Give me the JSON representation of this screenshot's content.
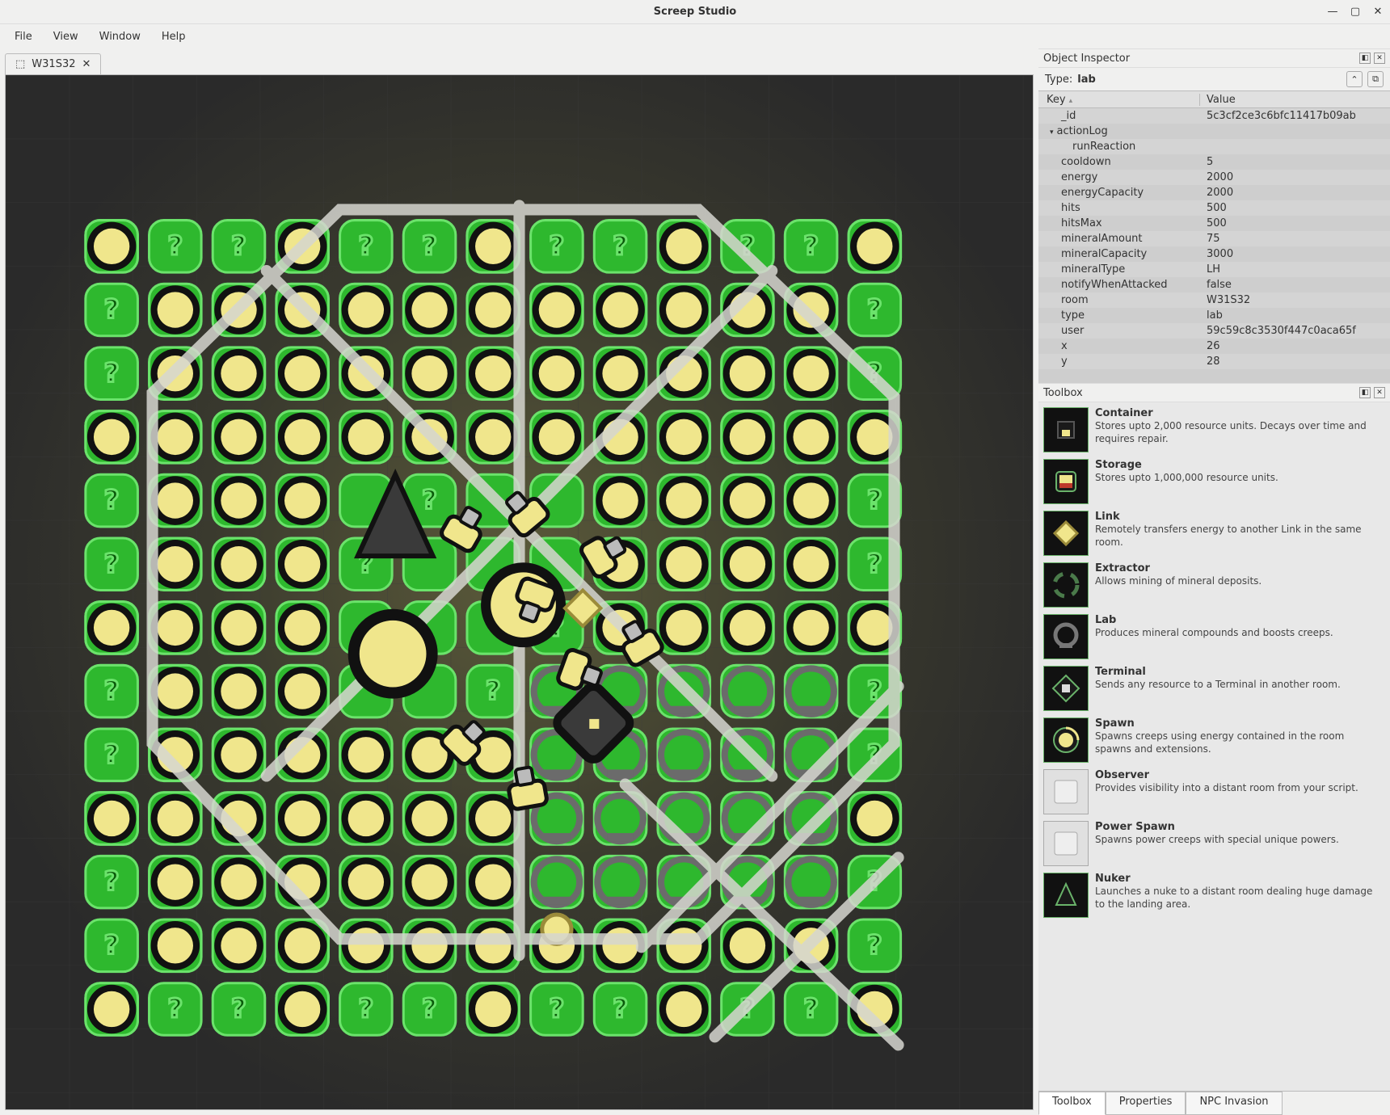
{
  "window": {
    "title": "Screep Studio"
  },
  "menu": {
    "file": "File",
    "view": "View",
    "window": "Window",
    "help": "Help"
  },
  "tab": {
    "label": "W31S32",
    "close": "✕"
  },
  "inspector": {
    "panel_title": "Object Inspector",
    "type_label": "Type:",
    "type_value": "lab",
    "key_header": "Key",
    "value_header": "Value",
    "rows": [
      {
        "k": "_id",
        "v": "5c3cf2ce3c6bfc11417b09ab"
      },
      {
        "k": "actionLog",
        "v": "",
        "expand": true
      },
      {
        "k": "runReaction",
        "v": "",
        "indent": 1
      },
      {
        "k": "cooldown",
        "v": "5"
      },
      {
        "k": "energy",
        "v": "2000"
      },
      {
        "k": "energyCapacity",
        "v": "2000"
      },
      {
        "k": "hits",
        "v": "500"
      },
      {
        "k": "hitsMax",
        "v": "500"
      },
      {
        "k": "mineralAmount",
        "v": "75"
      },
      {
        "k": "mineralCapacity",
        "v": "3000"
      },
      {
        "k": "mineralType",
        "v": "LH"
      },
      {
        "k": "notifyWhenAttacked",
        "v": "false"
      },
      {
        "k": "room",
        "v": "W31S32"
      },
      {
        "k": "type",
        "v": "lab"
      },
      {
        "k": "user",
        "v": "59c59c8c3530f447c0aca65f"
      },
      {
        "k": "x",
        "v": "26"
      },
      {
        "k": "y",
        "v": "28"
      }
    ]
  },
  "toolbox": {
    "panel_title": "Toolbox",
    "items": [
      {
        "name": "Container",
        "desc": "Stores upto 2,000 resource units. Decays over time and requires repair.",
        "icon": "container"
      },
      {
        "name": "Storage",
        "desc": "Stores upto 1,000,000 resource units.",
        "icon": "storage"
      },
      {
        "name": "Link",
        "desc": "Remotely transfers energy to another Link in the same room.",
        "icon": "link"
      },
      {
        "name": "Extractor",
        "desc": "Allows mining of mineral deposits.",
        "icon": "extractor"
      },
      {
        "name": "Lab",
        "desc": "Produces mineral compounds and boosts creeps.",
        "icon": "lab"
      },
      {
        "name": "Terminal",
        "desc": "Sends any resource to a Terminal in another room.",
        "icon": "terminal"
      },
      {
        "name": "Spawn",
        "desc": "Spawns creeps using energy contained in the room spawns and extensions.",
        "icon": "spawn"
      },
      {
        "name": "Observer",
        "desc": "Provides visibility into a distant room from your script.",
        "icon": "observer",
        "grey": true
      },
      {
        "name": "Power Spawn",
        "desc": "Spawns power creeps with special unique powers.",
        "icon": "powerspawn",
        "grey": true
      },
      {
        "name": "Nuker",
        "desc": "Launches a nuke to a distant room dealing huge damage to the landing area.",
        "icon": "nuker"
      }
    ]
  },
  "bottom_tabs": {
    "toolbox": "Toolbox",
    "properties": "Properties",
    "npc": "NPC Invasion"
  }
}
